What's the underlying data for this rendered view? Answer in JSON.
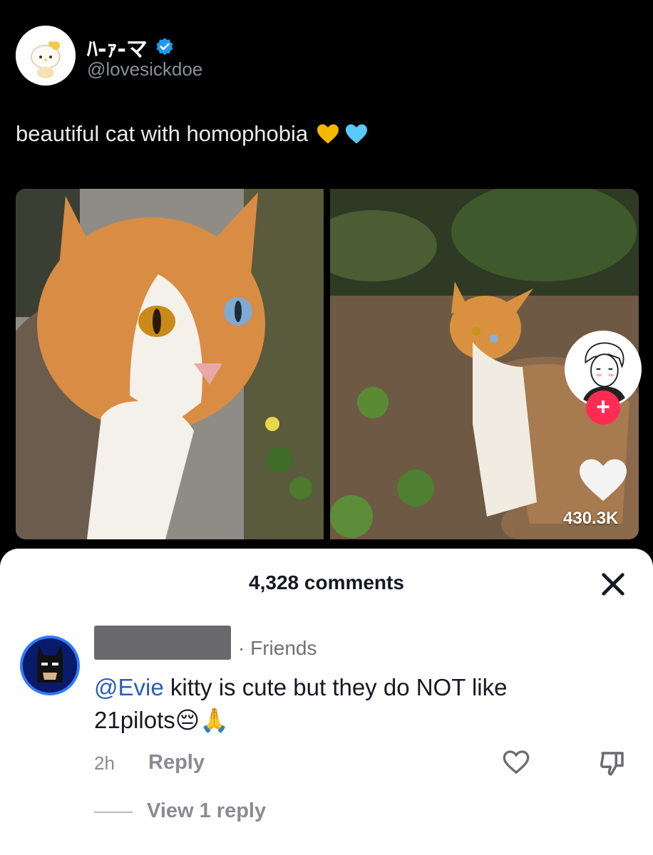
{
  "post": {
    "display_name": "ﾊ-ｧ-マ",
    "handle": "@lovesickdoe",
    "text": "beautiful cat with homophobia",
    "emojis": [
      "yellow-heart",
      "blue-heart"
    ]
  },
  "video": {
    "like_count": "430.3K",
    "follow_symbol": "+"
  },
  "comments": {
    "title": "4,328 comments",
    "close_symbol": "✕",
    "items": [
      {
        "tag": "· Friends",
        "mention": "@Evie",
        "text": " kitty is cute but they do NOT like 21pilots",
        "emoji": "😔🙏",
        "time": "2h",
        "reply_label": "Reply",
        "view_replies": "View 1 reply"
      }
    ]
  },
  "colors": {
    "background": "#000000",
    "sheet": "#ffffff",
    "mention": "#2b5db5",
    "follow": "#fe2c55",
    "verified": "#1d9bf0"
  }
}
